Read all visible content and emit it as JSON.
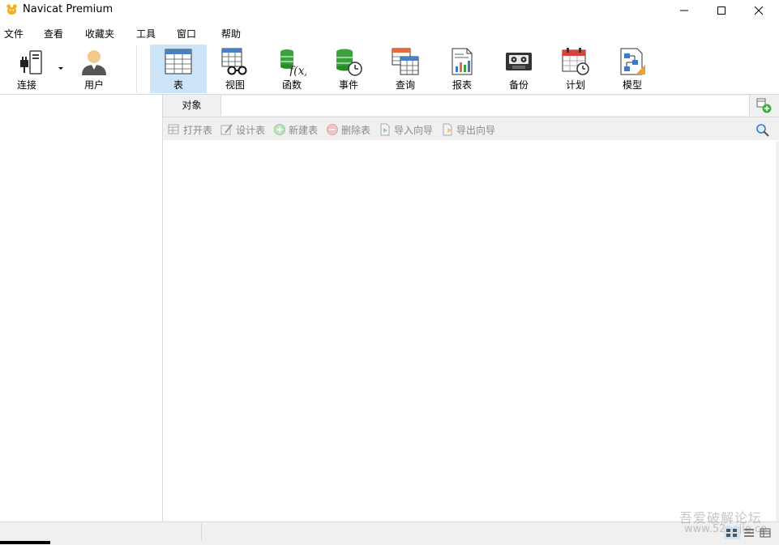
{
  "window": {
    "title": "Navicat Premium",
    "minimize_icon": "minimize-icon",
    "maximize_icon": "maximize-icon",
    "close_icon": "close-icon"
  },
  "menu": {
    "items": [
      "文件",
      "查看",
      "收藏夹",
      "工具",
      "窗口",
      "帮助"
    ]
  },
  "toolbar": {
    "items": [
      {
        "label": "连接",
        "icon": "connection-plug-icon"
      },
      {
        "label": "用户",
        "icon": "user-icon"
      },
      {
        "label": "表",
        "icon": "table-icon",
        "active": true
      },
      {
        "label": "视图",
        "icon": "view-glasses-icon"
      },
      {
        "label": "函数",
        "icon": "function-fx-icon"
      },
      {
        "label": "事件",
        "icon": "event-clock-icon"
      },
      {
        "label": "查询",
        "icon": "query-icon"
      },
      {
        "label": "报表",
        "icon": "report-icon"
      },
      {
        "label": "备份",
        "icon": "backup-tape-icon"
      },
      {
        "label": "计划",
        "icon": "schedule-calendar-icon"
      },
      {
        "label": "模型",
        "icon": "model-diagram-icon"
      }
    ]
  },
  "object_tab": {
    "label": "对象"
  },
  "actions": {
    "items": [
      {
        "label": "打开表",
        "icon": "open-table-icon"
      },
      {
        "label": "设计表",
        "icon": "design-table-icon"
      },
      {
        "label": "新建表",
        "icon": "new-table-icon"
      },
      {
        "label": "删除表",
        "icon": "delete-table-icon"
      },
      {
        "label": "导入向导",
        "icon": "import-wizard-icon"
      },
      {
        "label": "导出向导",
        "icon": "export-wizard-icon"
      }
    ],
    "search_icon": "search-icon"
  },
  "watermark": {
    "line1": "吾爱破解论坛",
    "line2": "www.52pojie.cn"
  },
  "colors": {
    "active_tab": "#cce4f7",
    "panel": "#f0f0f0",
    "disabled_text": "#8a8a8a"
  }
}
